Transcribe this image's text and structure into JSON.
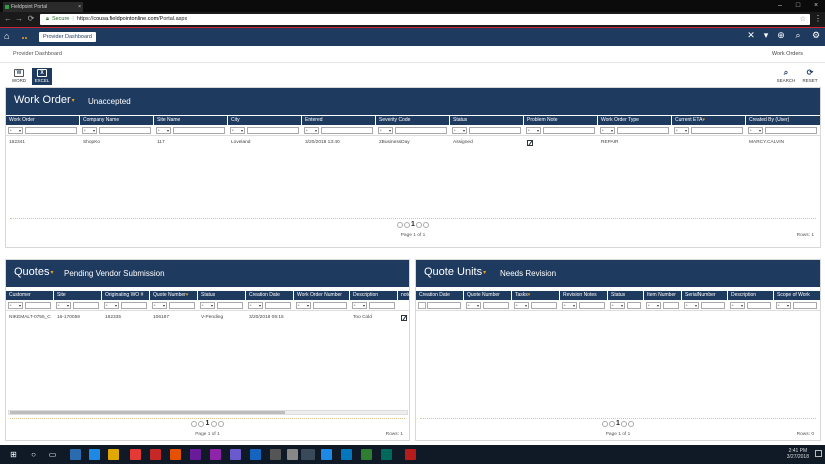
{
  "browser": {
    "tab_title": "Fieldpoint Portal",
    "tab_close": "×",
    "back": "←",
    "forward": "→",
    "reload": "⟳",
    "secure_label": "Secure",
    "url_prefix": "https://",
    "url_host": "cousa.fieldpointonline.com",
    "url_path": "/Portal.aspx",
    "star": "☆",
    "menu": "⋮",
    "min": "–",
    "max": "□",
    "close": "×"
  },
  "appbar": {
    "home": "⌂",
    "breadcrumb": "Provider Dashboard",
    "clear": "✕",
    "dropdown": "▾",
    "add": "⊕",
    "search": "⌕",
    "settings": "⚙"
  },
  "subbar": {
    "left": "Provider Dashboard",
    "right": "Work Orders"
  },
  "toolbar": {
    "word": "WORD",
    "excel": "EXCEL",
    "word_glyph": "W",
    "excel_glyph": "X",
    "search": "SEARCH",
    "reset": "RESET",
    "search_glyph": "⌕",
    "reset_glyph": "⟳"
  },
  "filter_op": "*",
  "filter_caret": "▾",
  "work_orders": {
    "title": "Work Order",
    "subtitle": "Unaccepted",
    "caret": "▾",
    "columns": [
      "Work Order",
      "Company Name",
      "Site Name",
      "City",
      "Entered",
      "Severity Code",
      "Status",
      "Problem Note",
      "Work Order Type",
      "Current ETA",
      "Created By (User)"
    ],
    "rows": [
      [
        "162341",
        "ShopKo",
        "117",
        "Loveland",
        "3/20/2018 13:40",
        "2BusinessDay",
        "Assigned",
        "",
        "REPAIR",
        "",
        "MARCY.CALVIN"
      ]
    ],
    "page": "1",
    "page_info": "Page 1 of 1",
    "rows_label": "Rows: 1"
  },
  "quotes": {
    "title": "Quotes",
    "subtitle": "Pending Vendor Submission",
    "caret": "▾",
    "columns": [
      "Customer",
      "Site",
      "Originating WO #",
      "Quote Number",
      "Status",
      "Creation Date",
      "Work Order Number",
      "Description",
      "note"
    ],
    "rows": [
      [
        "NIKEMALT-0755_C",
        "16-170059",
        "162335",
        "106187",
        "V-Pending",
        "3/20/2018 09:15",
        "",
        "Too Cold",
        ""
      ]
    ],
    "page": "1",
    "page_info": "Page 1 of 1",
    "rows_label": "Rows: 1"
  },
  "quote_units": {
    "title": "Quote Units",
    "subtitle": "Needs Revision",
    "caret": "▾",
    "columns": [
      "Creation Date",
      "Quote Number",
      "Tasks",
      "Revision Notes",
      "Status",
      "Item Number",
      "SerialNumber",
      "Description",
      "Scope of Work"
    ],
    "page": "1",
    "page_info": "Page 1 of 1",
    "rows_label": "Rows: 0"
  },
  "taskbar": {
    "start": "⊞",
    "search": "○",
    "task_view": "▭",
    "time": "2:41 PM",
    "date": "3/27/2018"
  },
  "colors": {
    "primary": "#1e3a5f",
    "accent": "#f0a020",
    "browser_dark": "#1a1a1a"
  }
}
